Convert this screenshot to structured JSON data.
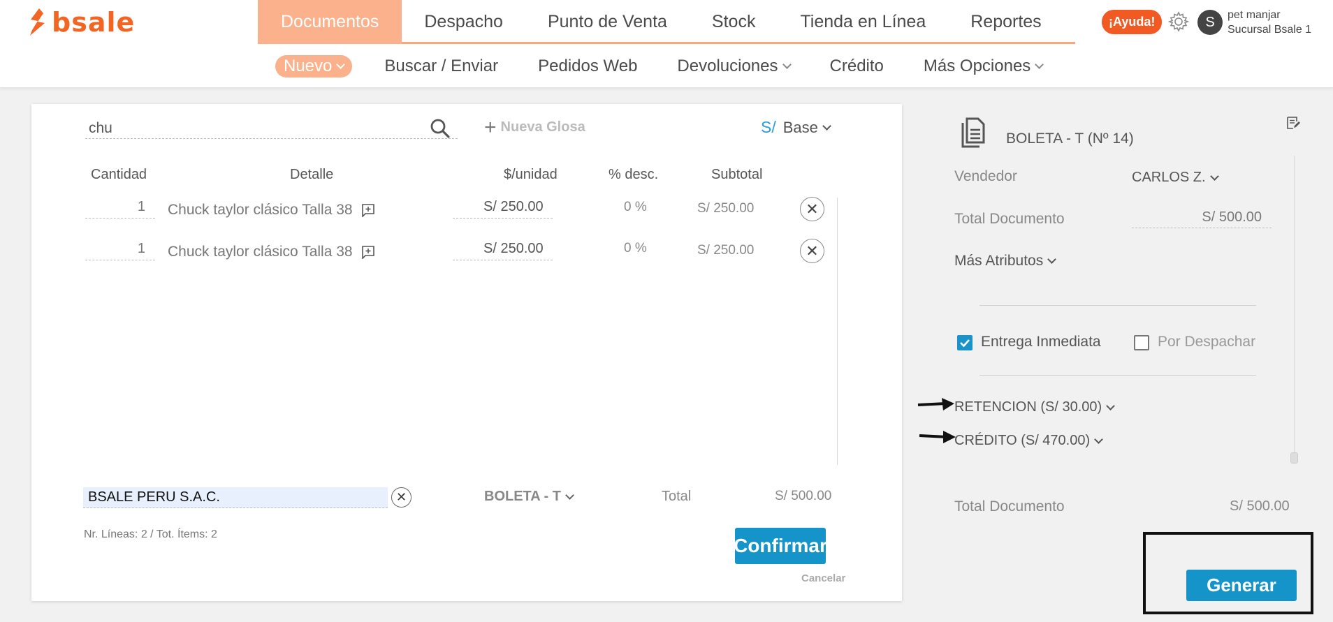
{
  "brand": {
    "name": "bsale",
    "color": "#f26522"
  },
  "main_nav": [
    {
      "label": "Documentos",
      "active": true
    },
    {
      "label": "Despacho"
    },
    {
      "label": "Punto de Venta"
    },
    {
      "label": "Stock"
    },
    {
      "label": "Tienda en Línea"
    },
    {
      "label": "Reportes"
    }
  ],
  "header": {
    "help_label": "¡Ayuda!",
    "avatar_initial": "S",
    "user_name": "pet manjar",
    "branch": "Sucursal Bsale 1"
  },
  "sub_nav": [
    {
      "label": "Nuevo",
      "active": true
    },
    {
      "label": "Buscar / Enviar"
    },
    {
      "label": "Pedidos Web"
    },
    {
      "label": "Devoluciones"
    },
    {
      "label": "Crédito"
    },
    {
      "label": "Más Opciones"
    }
  ],
  "editor": {
    "search_value": "chu",
    "nueva_glosa": "Nueva Glosa",
    "currency_symbol": "S/",
    "currency_mode": "Base",
    "columns": {
      "qty": "Cantidad",
      "detail": "Detalle",
      "unit_price": "$/unidad",
      "discount": "% desc.",
      "subtotal": "Subtotal"
    },
    "rows": [
      {
        "qty": "1",
        "detail": "Chuck taylor clásico Talla 38",
        "price": "S/ 250.00",
        "discount": "0 %",
        "subtotal": "S/ 250.00"
      },
      {
        "qty": "1",
        "detail": "Chuck taylor clásico Talla 38",
        "price": "S/ 250.00",
        "discount": "0 %",
        "subtotal": "S/ 250.00"
      }
    ],
    "client_value": "BSALE PERU S.A.C.",
    "doc_type": "BOLETA - T",
    "total_label": "Total",
    "total_value": "S/ 500.00",
    "lines_info": "Nr. Líneas: 2 / Tot. Ítems: 2",
    "confirm_label": "Confirmar",
    "cancel_label": "Cancelar"
  },
  "panel": {
    "doc_title": "BOLETA - T (Nº 14)",
    "vendor_label": "Vendedor",
    "vendor_value": "CARLOS Z.",
    "total_doc_label": "Total Documento",
    "total_doc_value": "S/ 500.00",
    "more_attrs": "Más Atributos",
    "entrega_label": "Entrega Inmediata",
    "entrega_checked": true,
    "despachar_label": "Por Despachar",
    "despachar_checked": false,
    "retencion": "RETENCION (S/ 30.00)",
    "credito": "CRÉDITO (S/ 470.00)",
    "bottom_total_label": "Total Documento",
    "bottom_total_value": "S/ 500.00",
    "generate_label": "Generar"
  },
  "colors": {
    "accent_orange": "#fbb28c",
    "help_red": "#f15a22",
    "primary_blue": "#1494c8"
  }
}
